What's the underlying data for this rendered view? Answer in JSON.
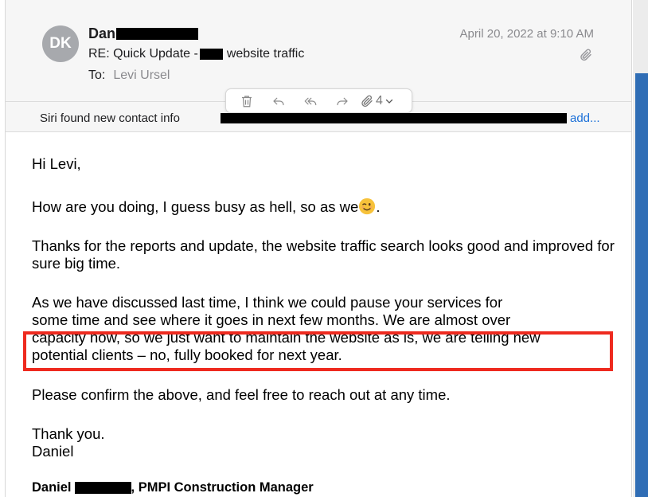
{
  "message": {
    "avatar_initials": "DK",
    "sender_name": "Dan",
    "subject_prefix": "RE: Quick Update -",
    "subject_suffix": "website traffic",
    "to_label": "To:",
    "recipient": "Levi Ursel",
    "date": "April 20, 2022 at 9:10 AM"
  },
  "toolbar": {
    "attachment_count": "4"
  },
  "siri": {
    "text": "Siri found new contact info",
    "add_label": "add..."
  },
  "body": {
    "greeting": "Hi Levi,",
    "para2_text": "How are you doing, I guess busy as hell, so as we",
    "para2_end": ".",
    "para3": "Thanks for the reports and update, the website traffic search looks good and improved for sure big time.",
    "para4_line1": "As we have discussed last time, I think we could pause your services for",
    "para4_line2": "some time and see where it goes in next few months. We are almost over",
    "para4_line3": "capacity now, so we just want to maintain the website as is, we are telling new",
    "para4_line4": "potential clients – no, fully booked for next year.",
    "para5": "Please confirm the above, and feel free to reach out at any time.",
    "closing": "Thank you.",
    "name": "Daniel",
    "sig_first": "Daniel",
    "sig_rest": ", PMPI Construction Manager"
  },
  "colors": {
    "highlight": "#ee2a1f",
    "link": "#1a6fd8",
    "avatar": "#a7a9ad"
  }
}
